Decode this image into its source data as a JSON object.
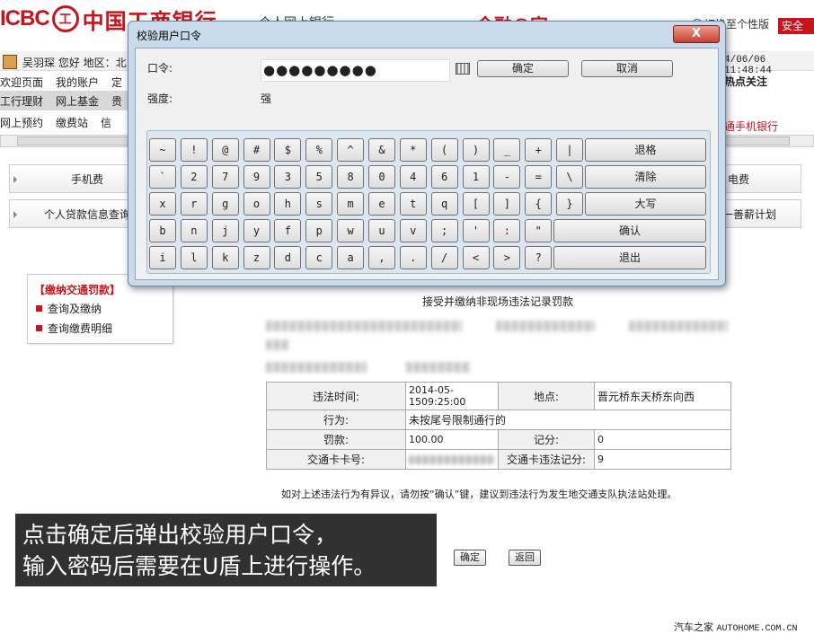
{
  "header": {
    "logo_text": "ICBC",
    "logo_seal": "工",
    "bank_name": "中国工商银行",
    "mid_text": "个人网上银行",
    "red_text": "金融@家",
    "switch_text": "切换至个性版",
    "safe_label": "安全"
  },
  "user_bar": {
    "greeting": "吴羽琛  您好  地区：北",
    "datetime": "4/06/06 11:48:44"
  },
  "nav": {
    "row1": [
      "欢迎页面",
      "我的账户",
      "定"
    ],
    "row2": [
      "工行理财",
      "网上基金",
      "贵"
    ],
    "row3": [
      "网上预约",
      "缴费站",
      "信"
    ],
    "hot": "热点关注",
    "mobile_bank": "通手机银行"
  },
  "service_buttons": {
    "row1": [
      "手机费",
      "电费"
    ],
    "row2": [
      "个人贷款信息查询",
      "捐款一善薪计划"
    ]
  },
  "left_panel": {
    "title": "【缴纳交通罚款】",
    "items": [
      "查询及缴纳",
      "查询缴费明细"
    ]
  },
  "main": {
    "title": "接受并缴纳非现场违法记录罚款",
    "table": {
      "time_label": "违法时间:",
      "time_value": "2014-05-1509:25:00",
      "place_label": "地点:",
      "place_value": "晋元桥东天桥东向西",
      "act_label": "行为:",
      "act_value": "未按尾号限制通行的",
      "fine_label": "罚款:",
      "fine_value": "100.00",
      "points_label": "记分:",
      "points_value": "0",
      "card_label": "交通卡卡号:",
      "card_points_label": "交通卡违法记分:",
      "card_points_value": "9"
    },
    "note": "如对上述违法行为有异议，请勿按“确认”键，建议到违法行为发生地交通支队执法站处理。",
    "confirm_label": "确定",
    "back_label": "返回"
  },
  "caption": {
    "line1": "点击确定后弹出校验用户口令，",
    "line2": "输入密码后需要在U盾上进行操作。"
  },
  "footer": {
    "site": "汽车之家",
    "url": "AUTOHOME.COM.CN"
  },
  "dialog": {
    "title": "校验用户口令",
    "close_label": "X",
    "password_label": "口令:",
    "password_value": "●●●●●●●●●",
    "ok_label": "确定",
    "cancel_label": "取消",
    "strength_label": "强度:",
    "strength_value": "强",
    "keys": {
      "row1": [
        "~",
        "!",
        "@",
        "#",
        "$",
        "%",
        "^",
        "&",
        "*",
        "(",
        ")",
        "_",
        "+",
        "|"
      ],
      "row1_action": "退格",
      "row2": [
        "`",
        "2",
        "7",
        "9",
        "3",
        "5",
        "8",
        "0",
        "4",
        "6",
        "1",
        "-",
        "=",
        "\\"
      ],
      "row2_action": "清除",
      "row3": [
        "x",
        "r",
        "g",
        "o",
        "h",
        "s",
        "m",
        "e",
        "t",
        "q",
        "[",
        "]",
        "{",
        "}"
      ],
      "row3_action": "大写",
      "row4": [
        "b",
        "n",
        "j",
        "y",
        "f",
        "p",
        "w",
        "u",
        "v",
        ";",
        "'",
        ":",
        "\""
      ],
      "row4_action": "确认",
      "row5": [
        "i",
        "l",
        "k",
        "z",
        "d",
        "c",
        "a",
        ",",
        ".",
        "/",
        "<",
        ">",
        "?"
      ],
      "row5_action": "退出"
    }
  },
  "colors": {
    "brand": "#c8151d",
    "dialog_frame": "#c9daea"
  }
}
